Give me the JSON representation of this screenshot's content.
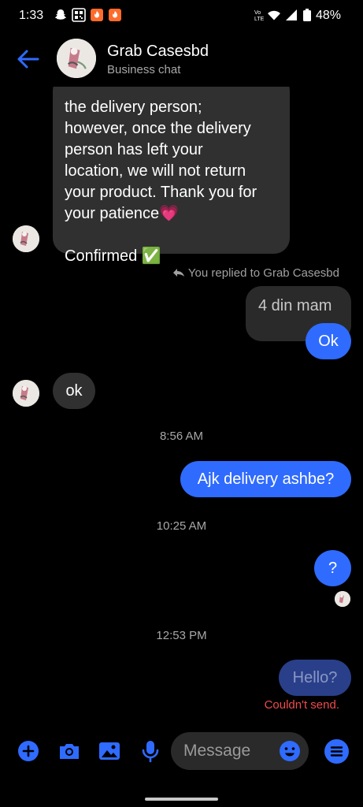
{
  "status_bar": {
    "time": "1:33",
    "battery": "48%"
  },
  "header": {
    "contact_name": "Grab Casesbd",
    "subtitle": "Business chat"
  },
  "messages": {
    "long_text": "the delivery person;\nhowever, once the delivery\nperson has left your\nlocation, we will not return\nyour product. Thank you for\nyour patience💗\n\nConfirmed ✅",
    "reply_label": "You replied to Grab Casesbd",
    "quoted": "4 din mam",
    "ok_out": "Ok",
    "ok_in": "ok",
    "time1": "8:56 AM",
    "ajk": "Ajk delivery ashbe?",
    "time2": "10:25 AM",
    "question": "?",
    "time3": "12:53 PM",
    "hello": "Hello?",
    "fail": "Couldn't send."
  },
  "composer": {
    "placeholder": "Message"
  },
  "colors": {
    "accent": "#2f6bff",
    "incoming_bubble": "#303030",
    "error": "#ef4b4b",
    "background": "#000000"
  }
}
